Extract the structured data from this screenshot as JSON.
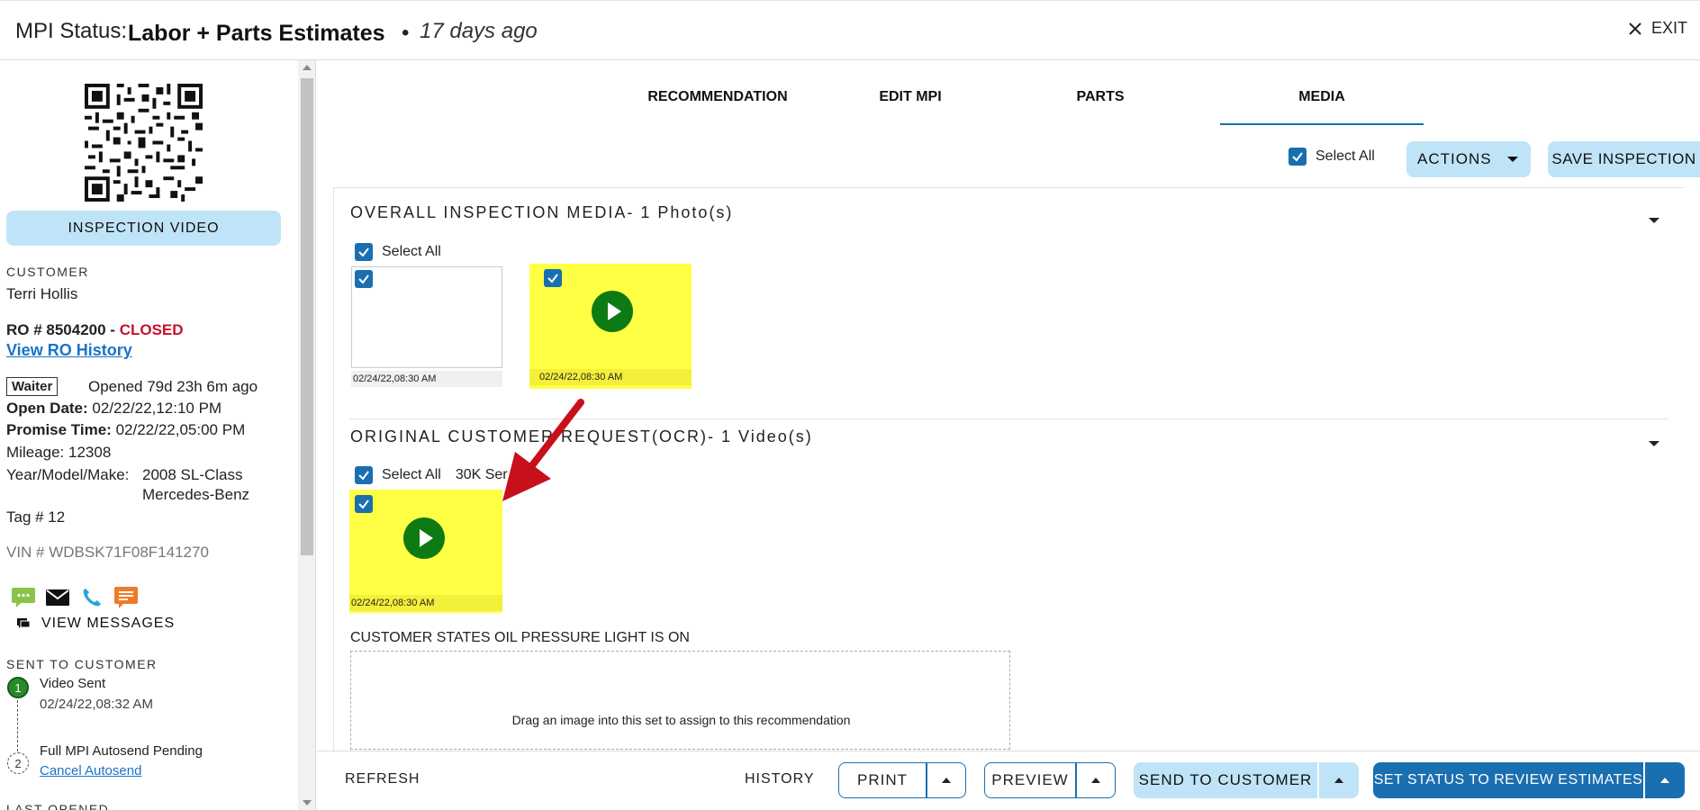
{
  "header": {
    "label": "MPI Status:",
    "status": "Labor + Parts Estimates",
    "separator": "•",
    "ago": "17 days ago",
    "exit_label": "EXIT"
  },
  "sidebar": {
    "inspection_video_label": "INSPECTION VIDEO",
    "customer_caption": "CUSTOMER",
    "customer_name": "Terri Hollis",
    "ro_prefix": "RO # 8504200 - ",
    "ro_status": "CLOSED",
    "ro_history_link": "View RO History",
    "waiter_badge": "Waiter",
    "opened": "Opened 79d 23h 6m ago",
    "open_date_label": "Open Date:",
    "open_date": "02/22/22,12:10 PM",
    "promise_label": "Promise Time:",
    "promise_time": "02/22/22,05:00 PM",
    "mileage_label": "Mileage:",
    "mileage": "12308",
    "ymm_label": "Year/Model/Make:",
    "ymm_line1": "2008 SL-Class",
    "ymm_line2": "Mercedes-Benz",
    "tag": "Tag # 12",
    "vin": "VIN # WDBSK71F08F141270",
    "view_messages": "VIEW MESSAGES",
    "sent_caption": "SENT TO CUSTOMER",
    "steps": [
      {
        "num": "1",
        "title": "Video Sent",
        "time": "02/24/22,08:32 AM"
      },
      {
        "num": "2",
        "title": "Full MPI Autosend Pending",
        "link": "Cancel Autosend"
      }
    ],
    "last_opened_caption": "LAST OPENED",
    "colors": {
      "sms": "#8bc34a",
      "email": "#111111",
      "phone": "#29a3e0",
      "chat": "#f07a2a"
    }
  },
  "tabs": [
    {
      "label": "RECOMMENDATION"
    },
    {
      "label": "EDIT MPI"
    },
    {
      "label": "PARTS"
    },
    {
      "label": "MEDIA"
    }
  ],
  "toolbar": {
    "select_all": "Select All",
    "actions": "ACTIONS",
    "save": "SAVE INSPECTION"
  },
  "sections": [
    {
      "title": "OVERALL INSPECTION MEDIA- 1 Photo(s)",
      "select_all": "Select All",
      "items": [
        {
          "date": "02/24/22,08:30 AM",
          "type": "photo"
        },
        {
          "date": "02/24/22,08:30 AM",
          "type": "video"
        }
      ]
    },
    {
      "title": "ORIGINAL CUSTOMER REQUEST(OCR)- 1 Video(s)",
      "select_all": "Select All",
      "extra": "30K Ser",
      "items": [
        {
          "date": "02/24/22,08:30 AM",
          "type": "video"
        }
      ],
      "request_text": "CUSTOMER STATES OIL PRESSURE LIGHT IS ON",
      "dropzone_text": "Drag an image into this set to assign to this recommendation"
    }
  ],
  "footer": {
    "refresh": "REFRESH",
    "history": "HISTORY",
    "print": "PRINT",
    "preview": "PREVIEW",
    "send": "SEND TO CUSTOMER",
    "set_status": "SET STATUS TO REVIEW ESTIMATES"
  }
}
